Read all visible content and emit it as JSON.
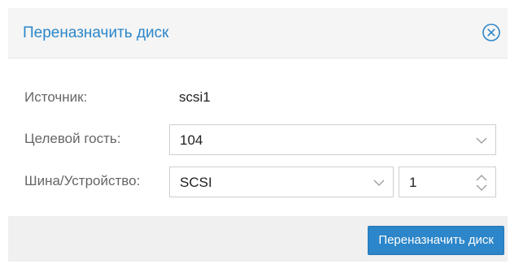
{
  "window": {
    "title": "Переназначить диск"
  },
  "form": {
    "source": {
      "label": "Источник:",
      "value": "scsi1"
    },
    "target_guest": {
      "label": "Целевой гость:",
      "value": "104"
    },
    "bus_device": {
      "label": "Шина/Устройство:",
      "bus_value": "SCSI",
      "device_value": "1"
    }
  },
  "footer": {
    "submit_label": "Переназначить диск"
  },
  "icons": {
    "close": "close-circle-icon",
    "dropdown": "chevron-down-icon",
    "spinner": "spinner-arrows-icon"
  },
  "colors": {
    "accent": "#2c86c9",
    "header_bg": "#f5f5f5",
    "footer_bg": "#f0f0f0"
  }
}
